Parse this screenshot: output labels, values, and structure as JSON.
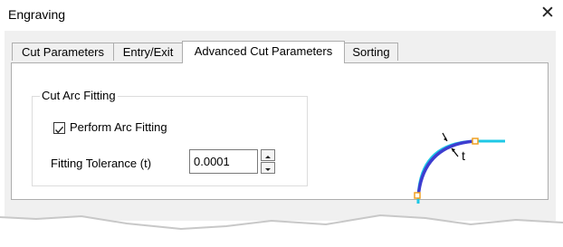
{
  "window": {
    "title": "Engraving",
    "close_icon": "close-icon"
  },
  "tabs": [
    {
      "label": "Cut Parameters",
      "active": false
    },
    {
      "label": "Entry/Exit",
      "active": false
    },
    {
      "label": "Advanced Cut Parameters",
      "active": true
    },
    {
      "label": "Sorting",
      "active": false
    }
  ],
  "group": {
    "label": "Cut Arc Fitting",
    "perform_arc_fitting": {
      "label": "Perform Arc Fitting",
      "checked": true
    },
    "fitting_tolerance": {
      "label": "Fitting Tolerance (t)",
      "value": "0.0001"
    }
  },
  "diagram": {
    "label": "t"
  },
  "colors": {
    "arc": "#3d3dd0",
    "path": "#1ec8e6",
    "point": "#f0a020"
  }
}
